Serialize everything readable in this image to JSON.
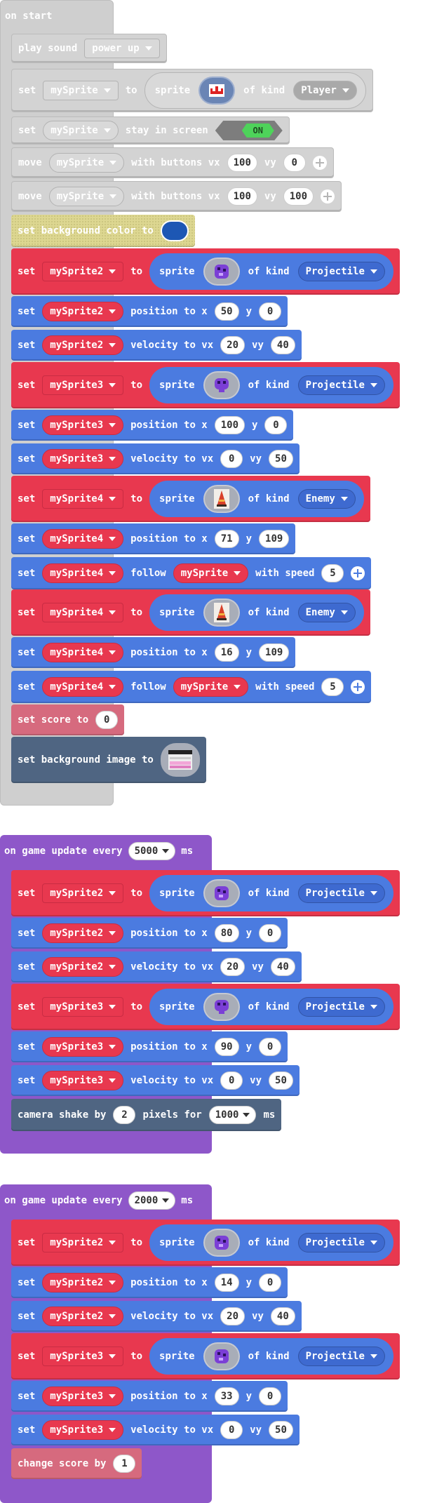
{
  "on_start": {
    "label": "on start",
    "play_sound": {
      "kw": "play sound",
      "sound": "power up"
    },
    "set_player": {
      "set": "set",
      "var": "mySprite",
      "to": "to",
      "sprite": "sprite",
      "of_kind": "of kind",
      "kind": "Player"
    },
    "stay": {
      "set": "set",
      "var": "mySprite",
      "text": "stay in screen",
      "toggle": "ON"
    },
    "move1": {
      "kw": "move",
      "var": "mySprite",
      "text": "with buttons vx",
      "vx": "100",
      "vy_lbl": "vy",
      "vy": "0"
    },
    "move2": {
      "kw": "move",
      "var": "mySprite",
      "text": "with buttons vx",
      "vx": "100",
      "vy_lbl": "vy",
      "vy": "100"
    },
    "bg_color": {
      "text": "set background color to",
      "color": "#1d57b4"
    },
    "s2": {
      "set": "set",
      "var": "mySprite2",
      "to": "to",
      "sprite": "sprite",
      "of_kind": "of kind",
      "kind": "Projectile"
    },
    "s2pos": {
      "set": "set",
      "var": "mySprite2",
      "text": "position to x",
      "x": "50",
      "y_lbl": "y",
      "y": "0"
    },
    "s2vel": {
      "set": "set",
      "var": "mySprite2",
      "text": "velocity to vx",
      "vx": "20",
      "vy_lbl": "vy",
      "vy": "40"
    },
    "s3": {
      "set": "set",
      "var": "mySprite3",
      "to": "to",
      "sprite": "sprite",
      "of_kind": "of kind",
      "kind": "Projectile"
    },
    "s3pos": {
      "set": "set",
      "var": "mySprite3",
      "text": "position to x",
      "x": "100",
      "y_lbl": "y",
      "y": "0"
    },
    "s3vel": {
      "set": "set",
      "var": "mySprite3",
      "text": "velocity to vx",
      "vx": "0",
      "vy_lbl": "vy",
      "vy": "50"
    },
    "s4a": {
      "set": "set",
      "var": "mySprite4",
      "to": "to",
      "sprite": "sprite",
      "of_kind": "of kind",
      "kind": "Enemy"
    },
    "s4apos": {
      "set": "set",
      "var": "mySprite4",
      "text": "position to x",
      "x": "71",
      "y_lbl": "y",
      "y": "109"
    },
    "s4afol": {
      "set": "set",
      "var": "mySprite4",
      "follow": "follow",
      "target": "mySprite",
      "with_speed": "with speed",
      "speed": "5"
    },
    "s4b": {
      "set": "set",
      "var": "mySprite4",
      "to": "to",
      "sprite": "sprite",
      "of_kind": "of kind",
      "kind": "Enemy"
    },
    "s4bpos": {
      "set": "set",
      "var": "mySprite4",
      "text": "position to x",
      "x": "16",
      "y_lbl": "y",
      "y": "109"
    },
    "s4bfol": {
      "set": "set",
      "var": "mySprite4",
      "follow": "follow",
      "target": "mySprite",
      "with_speed": "with speed",
      "speed": "5"
    },
    "score": {
      "text": "set score to",
      "value": "0"
    },
    "bg_image": {
      "text": "set background image to"
    }
  },
  "update1": {
    "label": "on game update every",
    "interval": "5000",
    "unit": "ms",
    "s2": {
      "set": "set",
      "var": "mySprite2",
      "to": "to",
      "sprite": "sprite",
      "of_kind": "of kind",
      "kind": "Projectile"
    },
    "s2pos": {
      "set": "set",
      "var": "mySprite2",
      "text": "position to x",
      "x": "80",
      "y_lbl": "y",
      "y": "0"
    },
    "s2vel": {
      "set": "set",
      "var": "mySprite2",
      "text": "velocity to vx",
      "vx": "20",
      "vy_lbl": "vy",
      "vy": "40"
    },
    "s3": {
      "set": "set",
      "var": "mySprite3",
      "to": "to",
      "sprite": "sprite",
      "of_kind": "of kind",
      "kind": "Projectile"
    },
    "s3pos": {
      "set": "set",
      "var": "mySprite3",
      "text": "position to x",
      "x": "90",
      "y_lbl": "y",
      "y": "0"
    },
    "s3vel": {
      "set": "set",
      "var": "mySprite3",
      "text": "velocity to vx",
      "vx": "0",
      "vy_lbl": "vy",
      "vy": "50"
    },
    "shake": {
      "text": "camera shake by",
      "pixels": "2",
      "pixels_for": "pixels for",
      "duration": "1000",
      "unit": "ms"
    }
  },
  "update2": {
    "label": "on game update every",
    "interval": "2000",
    "unit": "ms",
    "s2": {
      "set": "set",
      "var": "mySprite2",
      "to": "to",
      "sprite": "sprite",
      "of_kind": "of kind",
      "kind": "Projectile"
    },
    "s2pos": {
      "set": "set",
      "var": "mySprite2",
      "text": "position to x",
      "x": "14",
      "y_lbl": "y",
      "y": "0"
    },
    "s2vel": {
      "set": "set",
      "var": "mySprite2",
      "text": "velocity to vx",
      "vx": "20",
      "vy_lbl": "vy",
      "vy": "40"
    },
    "s3": {
      "set": "set",
      "var": "mySprite3",
      "to": "to",
      "sprite": "sprite",
      "of_kind": "of kind",
      "kind": "Projectile"
    },
    "s3pos": {
      "set": "set",
      "var": "mySprite3",
      "text": "position to x",
      "x": "33",
      "y_lbl": "y",
      "y": "0"
    },
    "s3vel": {
      "set": "set",
      "var": "mySprite3",
      "text": "velocity to vx",
      "vx": "0",
      "vy_lbl": "vy",
      "vy": "50"
    },
    "change_score": {
      "text": "change score by",
      "value": "1"
    }
  }
}
